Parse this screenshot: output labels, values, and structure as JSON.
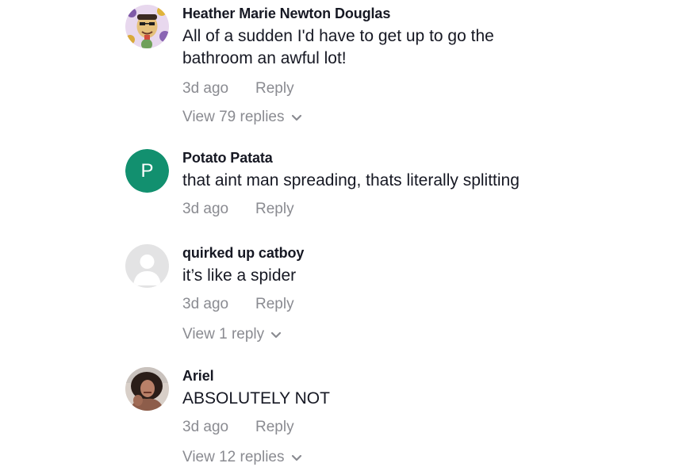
{
  "comments": [
    {
      "username": "Heather Marie Newton Douglas",
      "text": "All of a sudden I'd have to get up to go the bathroom an awful lot!",
      "time": "3d ago",
      "reply_label": "Reply",
      "view_replies": "View 79 replies",
      "avatar": "cartoon-face-icon"
    },
    {
      "username": "Potato Patata",
      "text": "that aint man spreading, thats literally splitting",
      "time": "3d ago",
      "reply_label": "Reply",
      "avatar_letter": "P",
      "avatar_color": "#12906f"
    },
    {
      "username": "quirked up catboy",
      "text": "it’s like a spider",
      "time": "3d ago",
      "reply_label": "Reply",
      "view_replies": "View 1 reply",
      "avatar": "default-user-icon"
    },
    {
      "username": "Ariel",
      "text": "ABSOLUTELY NOT",
      "time": "3d ago",
      "reply_label": "Reply",
      "view_replies": "View 12 replies",
      "avatar": "photo-avatar"
    }
  ],
  "colors": {
    "text_primary": "#161823",
    "text_secondary": "#8a8b91",
    "letter_avatar_bg": "#12906f"
  }
}
